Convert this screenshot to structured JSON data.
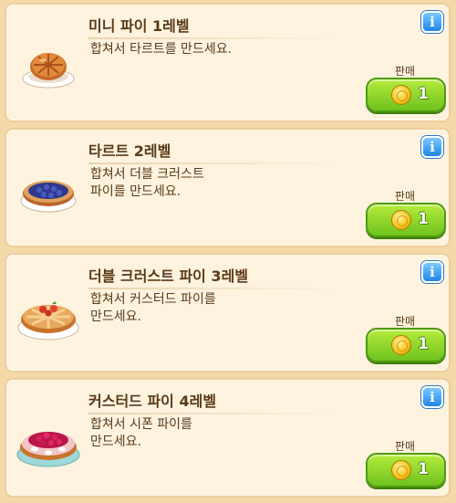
{
  "items": [
    {
      "title": "미니 파이 1레벨",
      "description": "합쳐서 타르트를 만드세요.",
      "sell_label": "판매",
      "price": "1",
      "icon": "mini-pie-icon",
      "info_icon": "i"
    },
    {
      "title": "타르트 2레벨",
      "description": "합쳐서 더블 크러스트\n파이를 만드세요.",
      "sell_label": "판매",
      "price": "1",
      "icon": "blueberry-tart-icon",
      "info_icon": "i"
    },
    {
      "title": "더블 크러스트 파이 3레벨",
      "description": "합쳐서 커스터드 파이를\n만드세요.",
      "sell_label": "판매",
      "price": "1",
      "icon": "double-crust-pie-icon",
      "info_icon": "i"
    },
    {
      "title": "커스터드 파이 4레벨",
      "description": "합쳐서 시폰 파이를\n만드세요.",
      "sell_label": "판매",
      "price": "1",
      "icon": "custard-pie-icon",
      "info_icon": "i"
    }
  ],
  "colors": {
    "card_bg": "#fdf3df",
    "text": "#5a3a18",
    "sell_button": "#8fd62a",
    "info_button": "#1f86e8"
  }
}
